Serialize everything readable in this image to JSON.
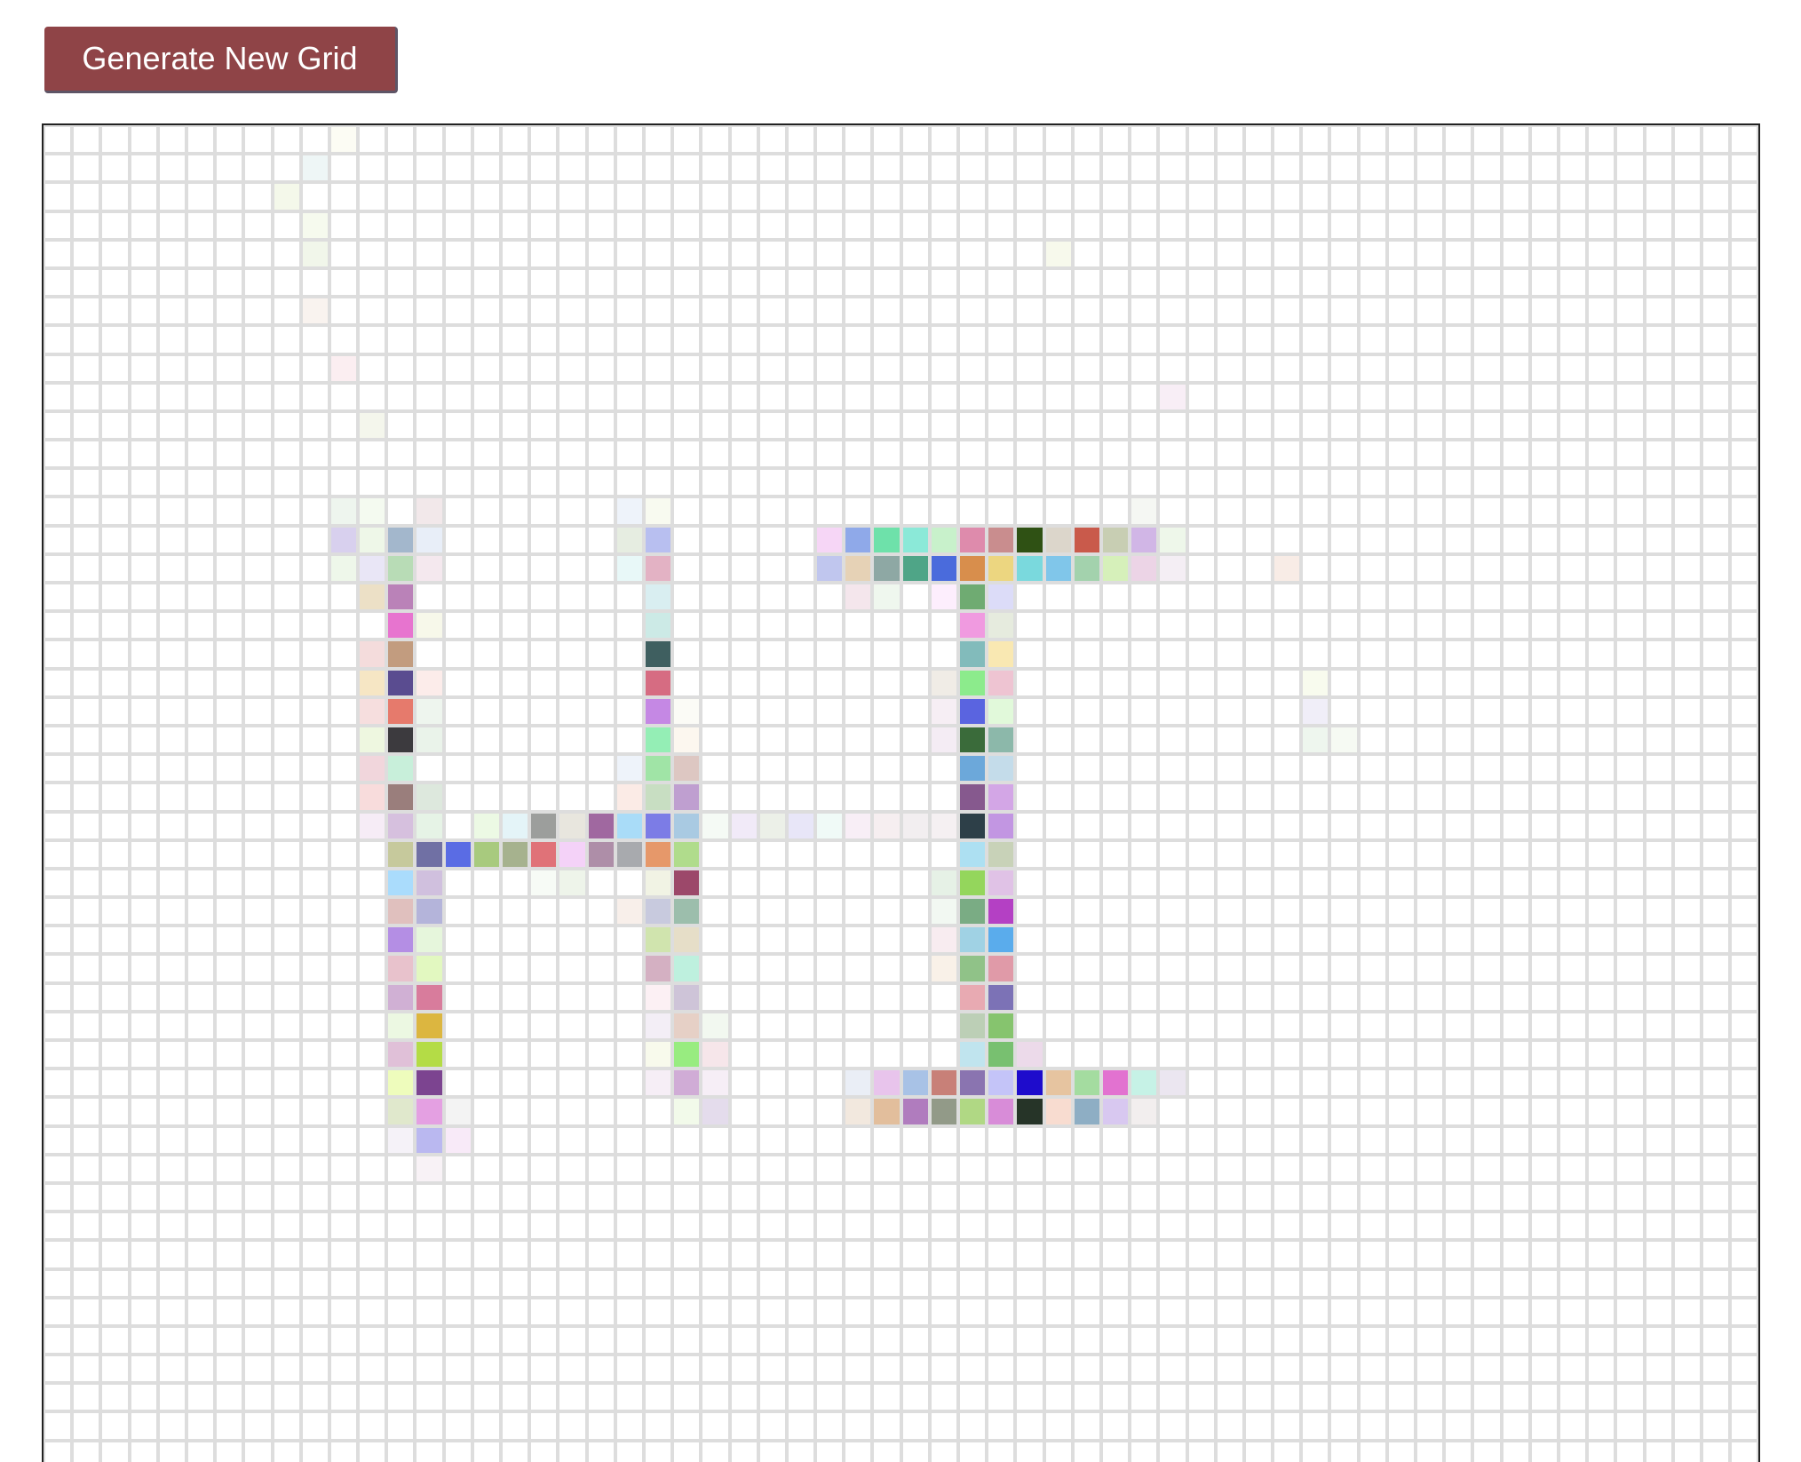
{
  "generate_button": {
    "label": "Generate New Grid"
  },
  "grid": {
    "columns": 60,
    "rows": 47,
    "line_color": "#dddddd",
    "frame_color": "#222222",
    "painted_cells": [
      [
        0,
        10,
        "#fcfcf4"
      ],
      [
        1,
        9,
        "#eef6f6"
      ],
      [
        2,
        8,
        "#f4f8ea"
      ],
      [
        3,
        9,
        "#f6faee"
      ],
      [
        4,
        9,
        "#f1f6ea"
      ],
      [
        6,
        9,
        "#f9f3ef"
      ],
      [
        8,
        10,
        "#fbeef1"
      ],
      [
        10,
        11,
        "#f4f6ec"
      ],
      [
        4,
        35,
        "#f7f9ec"
      ],
      [
        9,
        39,
        "#f8eef6"
      ],
      [
        13,
        10,
        "#eef5ee"
      ],
      [
        13,
        11,
        "#f4faf0"
      ],
      [
        13,
        13,
        "#f2e8ea"
      ],
      [
        13,
        20,
        "#eef3fa"
      ],
      [
        13,
        21,
        "#f8faf0"
      ],
      [
        13,
        38,
        "#f5f7f3"
      ],
      [
        14,
        10,
        "#d8d0ee"
      ],
      [
        14,
        11,
        "#eef7e8"
      ],
      [
        14,
        12,
        "#a3b7cc"
      ],
      [
        14,
        13,
        "#e8eef8"
      ],
      [
        14,
        20,
        "#e6ede1"
      ],
      [
        14,
        21,
        "#b8bff0"
      ],
      [
        14,
        27,
        "#f6d6f6"
      ],
      [
        14,
        28,
        "#8fa9e9"
      ],
      [
        14,
        29,
        "#6ee1aa"
      ],
      [
        14,
        30,
        "#8be9d8"
      ],
      [
        14,
        31,
        "#c8f1cb"
      ],
      [
        14,
        32,
        "#de8bac"
      ],
      [
        14,
        33,
        "#c98d8e"
      ],
      [
        14,
        34,
        "#2f5114"
      ],
      [
        14,
        35,
        "#dcd6cb"
      ],
      [
        14,
        36,
        "#c95a4b"
      ],
      [
        14,
        37,
        "#c8ceb3"
      ],
      [
        14,
        38,
        "#d1b6e6"
      ],
      [
        14,
        39,
        "#eef7ea"
      ],
      [
        15,
        10,
        "#eef7ea"
      ],
      [
        15,
        11,
        "#e9e6f6"
      ],
      [
        15,
        12,
        "#b8dcb6"
      ],
      [
        15,
        13,
        "#f4e8ee"
      ],
      [
        15,
        20,
        "#e8f8f8"
      ],
      [
        15,
        21,
        "#e3b2c4"
      ],
      [
        15,
        27,
        "#c0c6ee"
      ],
      [
        15,
        28,
        "#e6d2b6"
      ],
      [
        15,
        29,
        "#8ea8a4"
      ],
      [
        15,
        30,
        "#4fa587"
      ],
      [
        15,
        31,
        "#4a6bdc"
      ],
      [
        15,
        32,
        "#d88e4c"
      ],
      [
        15,
        33,
        "#ecd680"
      ],
      [
        15,
        34,
        "#7ad9dd"
      ],
      [
        15,
        35,
        "#80c6ea"
      ],
      [
        15,
        36,
        "#a3d2ad"
      ],
      [
        15,
        37,
        "#d6f0ba"
      ],
      [
        15,
        38,
        "#ecd4e6"
      ],
      [
        15,
        39,
        "#f4eef4"
      ],
      [
        15,
        43,
        "#f8ece6"
      ],
      [
        16,
        11,
        "#ece0c6"
      ],
      [
        16,
        12,
        "#ba82b8"
      ],
      [
        16,
        21,
        "#d9eef1"
      ],
      [
        16,
        28,
        "#f4e6ec"
      ],
      [
        16,
        29,
        "#eff7ee"
      ],
      [
        16,
        31,
        "#fdeefd"
      ],
      [
        16,
        32,
        "#6fab72"
      ],
      [
        16,
        33,
        "#dcdcf8"
      ],
      [
        17,
        12,
        "#e774cf"
      ],
      [
        17,
        13,
        "#f7f8ea"
      ],
      [
        17,
        21,
        "#cceae6"
      ],
      [
        17,
        32,
        "#f09ae0"
      ],
      [
        17,
        33,
        "#e6ebde"
      ],
      [
        18,
        11,
        "#f4dcdc"
      ],
      [
        18,
        12,
        "#c29c7f"
      ],
      [
        18,
        21,
        "#3f5f60"
      ],
      [
        18,
        32,
        "#82bbbb"
      ],
      [
        18,
        33,
        "#f9e8b2"
      ],
      [
        19,
        11,
        "#f6e6c4"
      ],
      [
        19,
        12,
        "#5a4c90"
      ],
      [
        19,
        13,
        "#fcecea"
      ],
      [
        19,
        21,
        "#d66c82"
      ],
      [
        19,
        31,
        "#f0ece6"
      ],
      [
        19,
        32,
        "#8ceb8c"
      ],
      [
        19,
        33,
        "#eec4d2"
      ],
      [
        19,
        44,
        "#f8fbee"
      ],
      [
        20,
        11,
        "#f6dede"
      ],
      [
        20,
        12,
        "#e67a6c"
      ],
      [
        20,
        13,
        "#eef5ee"
      ],
      [
        20,
        21,
        "#c588e4"
      ],
      [
        20,
        22,
        "#fbfbf6"
      ],
      [
        20,
        31,
        "#f6eef4"
      ],
      [
        20,
        32,
        "#5a64e0"
      ],
      [
        20,
        33,
        "#e1f9da"
      ],
      [
        20,
        44,
        "#f0eef8"
      ],
      [
        21,
        11,
        "#eef7e0"
      ],
      [
        21,
        12,
        "#3c3a3e"
      ],
      [
        21,
        13,
        "#eaf3ea"
      ],
      [
        21,
        21,
        "#94eeb5"
      ],
      [
        21,
        22,
        "#fcf7ef"
      ],
      [
        21,
        31,
        "#f4ecf4"
      ],
      [
        21,
        32,
        "#3a6b3a"
      ],
      [
        21,
        33,
        "#8cb8aa"
      ],
      [
        21,
        44,
        "#eef6ee"
      ],
      [
        21,
        45,
        "#f6faf3"
      ],
      [
        22,
        11,
        "#f1d6dc"
      ],
      [
        22,
        12,
        "#c8efda"
      ],
      [
        22,
        20,
        "#eef3fa"
      ],
      [
        22,
        21,
        "#a0e4a6"
      ],
      [
        22,
        22,
        "#ddc7c2"
      ],
      [
        22,
        32,
        "#6ca8da"
      ],
      [
        22,
        33,
        "#c4dcea"
      ],
      [
        23,
        11,
        "#f8dcdc"
      ],
      [
        23,
        12,
        "#9a7e7c"
      ],
      [
        23,
        13,
        "#dde8dd"
      ],
      [
        23,
        20,
        "#fbebe6"
      ],
      [
        23,
        21,
        "#c8dec2"
      ],
      [
        23,
        22,
        "#bf9fd0"
      ],
      [
        23,
        32,
        "#86598e"
      ],
      [
        23,
        33,
        "#d3a6e6"
      ],
      [
        24,
        11,
        "#f6ecf6"
      ],
      [
        24,
        12,
        "#d6c0de"
      ],
      [
        24,
        13,
        "#e6f3e6"
      ],
      [
        24,
        15,
        "#ecf9e4"
      ],
      [
        24,
        16,
        "#e4f4f8"
      ],
      [
        24,
        17,
        "#9c9e9c"
      ],
      [
        24,
        18,
        "#e8e6de"
      ],
      [
        24,
        19,
        "#a068a0"
      ],
      [
        24,
        20,
        "#a9dcf8"
      ],
      [
        24,
        21,
        "#7c7ce6"
      ],
      [
        24,
        22,
        "#a9cae2"
      ],
      [
        24,
        23,
        "#f5faf5"
      ],
      [
        24,
        24,
        "#f1eaf8"
      ],
      [
        24,
        25,
        "#ecf0e8"
      ],
      [
        24,
        26,
        "#e8e6f8"
      ],
      [
        24,
        27,
        "#f0faf7"
      ],
      [
        24,
        28,
        "#f8eef6"
      ],
      [
        24,
        29,
        "#f6eef0"
      ],
      [
        24,
        30,
        "#f2eef0"
      ],
      [
        24,
        31,
        "#f5f0f2"
      ],
      [
        24,
        32,
        "#2d3f48"
      ],
      [
        24,
        33,
        "#c296e2"
      ],
      [
        25,
        12,
        "#c6c99c"
      ],
      [
        25,
        13,
        "#7070a4"
      ],
      [
        25,
        14,
        "#5a6ce4"
      ],
      [
        25,
        15,
        "#a8ca7e"
      ],
      [
        25,
        16,
        "#a6b28e"
      ],
      [
        25,
        17,
        "#e07278"
      ],
      [
        25,
        18,
        "#f4d2f8"
      ],
      [
        25,
        19,
        "#ae8ea8"
      ],
      [
        25,
        20,
        "#a8aaae"
      ],
      [
        25,
        21,
        "#e6986a"
      ],
      [
        25,
        22,
        "#b0dc8c"
      ],
      [
        25,
        32,
        "#ade0f2"
      ],
      [
        25,
        33,
        "#c8d2b8"
      ],
      [
        26,
        12,
        "#aadcfc"
      ],
      [
        26,
        13,
        "#d0c0de"
      ],
      [
        26,
        17,
        "#f7fbf6"
      ],
      [
        26,
        18,
        "#eef4ea"
      ],
      [
        26,
        21,
        "#f1f3e4"
      ],
      [
        26,
        22,
        "#9c486a"
      ],
      [
        26,
        31,
        "#e6f1e6"
      ],
      [
        26,
        32,
        "#94d65c"
      ],
      [
        26,
        33,
        "#e0c2e6"
      ],
      [
        27,
        12,
        "#e0c0be"
      ],
      [
        27,
        13,
        "#b4b4da"
      ],
      [
        27,
        20,
        "#f8efea"
      ],
      [
        27,
        21,
        "#c8cade"
      ],
      [
        27,
        22,
        "#9cbeac"
      ],
      [
        27,
        31,
        "#f2f8f2"
      ],
      [
        27,
        32,
        "#7aac84"
      ],
      [
        27,
        33,
        "#b440c4"
      ],
      [
        28,
        12,
        "#b48ee4"
      ],
      [
        28,
        13,
        "#e6f6dc"
      ],
      [
        28,
        21,
        "#d0e4ae"
      ],
      [
        28,
        22,
        "#e6dec8"
      ],
      [
        28,
        31,
        "#f8ecf0"
      ],
      [
        28,
        32,
        "#a0d2e4"
      ],
      [
        28,
        33,
        "#5aacec"
      ],
      [
        29,
        12,
        "#e8c2cc"
      ],
      [
        29,
        13,
        "#e2f8c0"
      ],
      [
        29,
        21,
        "#d4b0c2"
      ],
      [
        29,
        22,
        "#bef0de"
      ],
      [
        29,
        31,
        "#f9f1e8"
      ],
      [
        29,
        32,
        "#90c288"
      ],
      [
        29,
        33,
        "#e09aa8"
      ],
      [
        30,
        12,
        "#d0b0d4"
      ],
      [
        30,
        13,
        "#d87c9c"
      ],
      [
        30,
        21,
        "#fcf0f4"
      ],
      [
        30,
        22,
        "#cec4d8"
      ],
      [
        30,
        32,
        "#e8aab2"
      ],
      [
        30,
        33,
        "#7c72b6"
      ],
      [
        31,
        12,
        "#ecf8e2"
      ],
      [
        31,
        13,
        "#dcb640"
      ],
      [
        31,
        21,
        "#f3eef6"
      ],
      [
        31,
        22,
        "#e6d0c6"
      ],
      [
        31,
        23,
        "#f2f8f0"
      ],
      [
        31,
        32,
        "#bccfb6"
      ],
      [
        31,
        33,
        "#86c46e"
      ],
      [
        32,
        12,
        "#e0c0d8"
      ],
      [
        32,
        13,
        "#b4dc46"
      ],
      [
        32,
        21,
        "#f8faec"
      ],
      [
        32,
        22,
        "#98ec80"
      ],
      [
        32,
        23,
        "#f6e6ea"
      ],
      [
        32,
        32,
        "#c0e4ee"
      ],
      [
        32,
        33,
        "#78c070"
      ],
      [
        32,
        34,
        "#ecdaea"
      ],
      [
        33,
        12,
        "#eefcbc"
      ],
      [
        33,
        13,
        "#7c4490"
      ],
      [
        33,
        21,
        "#f6eef6"
      ],
      [
        33,
        22,
        "#d0acd6"
      ],
      [
        33,
        23,
        "#f6eef6"
      ],
      [
        33,
        28,
        "#eaeef6"
      ],
      [
        33,
        29,
        "#e8c4ec"
      ],
      [
        33,
        30,
        "#a8c2e6"
      ],
      [
        33,
        31,
        "#c88078"
      ],
      [
        33,
        32,
        "#8a74b0"
      ],
      [
        33,
        33,
        "#c4c4f8"
      ],
      [
        33,
        34,
        "#1e0ccc"
      ],
      [
        33,
        35,
        "#e6c4a0"
      ],
      [
        33,
        36,
        "#a4dca0"
      ],
      [
        33,
        37,
        "#e272d0"
      ],
      [
        33,
        38,
        "#c6f2e6"
      ],
      [
        33,
        39,
        "#ebe6f0"
      ],
      [
        34,
        12,
        "#e0e8cc"
      ],
      [
        34,
        13,
        "#e4a0e2"
      ],
      [
        34,
        14,
        "#f3f3f3"
      ],
      [
        34,
        22,
        "#f2faea"
      ],
      [
        34,
        23,
        "#e4dcec"
      ],
      [
        34,
        28,
        "#f2e8de"
      ],
      [
        34,
        29,
        "#e2be9c"
      ],
      [
        34,
        30,
        "#b07cbe"
      ],
      [
        34,
        31,
        "#929a88"
      ],
      [
        34,
        32,
        "#b0d884"
      ],
      [
        34,
        33,
        "#d88cd8"
      ],
      [
        34,
        34,
        "#263428"
      ],
      [
        34,
        35,
        "#f8dcd0"
      ],
      [
        34,
        36,
        "#8eaec4"
      ],
      [
        34,
        37,
        "#d8c8f0"
      ],
      [
        34,
        38,
        "#f2eeee"
      ],
      [
        35,
        12,
        "#f5f2f8"
      ],
      [
        35,
        13,
        "#bab8f0"
      ],
      [
        35,
        14,
        "#f8eaf8"
      ],
      [
        36,
        13,
        "#f8f2f6"
      ]
    ]
  }
}
